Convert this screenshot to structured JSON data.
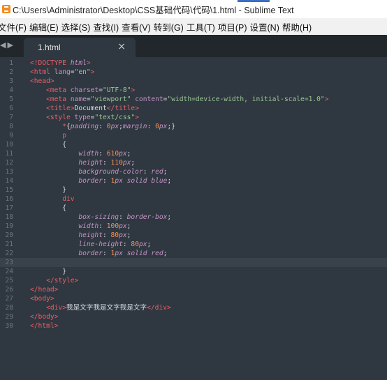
{
  "window": {
    "title": "C:\\Users\\Administrator\\Desktop\\CSS基础代码\\代码\\1.html - Sublime Text"
  },
  "menu": [
    "文件(F)",
    "编辑(E)",
    "选择(S)",
    "查找(I)",
    "查看(V)",
    "转到(G)",
    "工具(T)",
    "项目(P)",
    "设置(N)",
    "帮助(H)"
  ],
  "tabs": [
    {
      "label": "1.html",
      "close": "×"
    }
  ],
  "nav": {
    "back": "◀",
    "forward": "▶"
  },
  "colors": {
    "background": "#2f3740",
    "tag": "#ec5f67",
    "attribute": "#c594c5",
    "string": "#99c794",
    "number": "#f99157",
    "text": "#d8dee4"
  },
  "editor": {
    "active_line": 23,
    "lines": [
      {
        "n": "1",
        "t": "<!DOCTYPE html>"
      },
      {
        "n": "2",
        "t": "<html lang=\"en\">"
      },
      {
        "n": "3",
        "t": "<head>"
      },
      {
        "n": "4",
        "t": "    <meta charset=\"UTF-8\">"
      },
      {
        "n": "5",
        "t": "    <meta name=\"viewport\" content=\"width=device-width, initial-scale=1.0\">"
      },
      {
        "n": "6",
        "t": "    <title>Document</title>"
      },
      {
        "n": "7",
        "t": "    <style type=\"text/css\">"
      },
      {
        "n": "8",
        "t": "        *{padding: 0px;margin: 0px;}"
      },
      {
        "n": "9",
        "t": "        p"
      },
      {
        "n": "10",
        "t": "        {"
      },
      {
        "n": "11",
        "t": "            width: 610px;"
      },
      {
        "n": "12",
        "t": "            height: 110px;"
      },
      {
        "n": "13",
        "t": "            background-color: red;"
      },
      {
        "n": "14",
        "t": "            border: 1px solid blue;"
      },
      {
        "n": "15",
        "t": "        }"
      },
      {
        "n": "16",
        "t": "        div"
      },
      {
        "n": "17",
        "t": "        {"
      },
      {
        "n": "18",
        "t": "            box-sizing: border-box;"
      },
      {
        "n": "19",
        "t": "            width: 100px;"
      },
      {
        "n": "20",
        "t": "            height: 80px;"
      },
      {
        "n": "21",
        "t": "            line-height: 80px;"
      },
      {
        "n": "22",
        "t": "            border: 1px solid red;"
      },
      {
        "n": "23",
        "t": ""
      },
      {
        "n": "24",
        "t": "        }"
      },
      {
        "n": "25",
        "t": "    </style>"
      },
      {
        "n": "26",
        "t": "</head>"
      },
      {
        "n": "27",
        "t": "<body>"
      },
      {
        "n": "28",
        "t": "    <div>我是文字我是文字我是文字</div>"
      },
      {
        "n": "29",
        "t": "</body>"
      },
      {
        "n": "30",
        "t": "</html>"
      }
    ]
  }
}
